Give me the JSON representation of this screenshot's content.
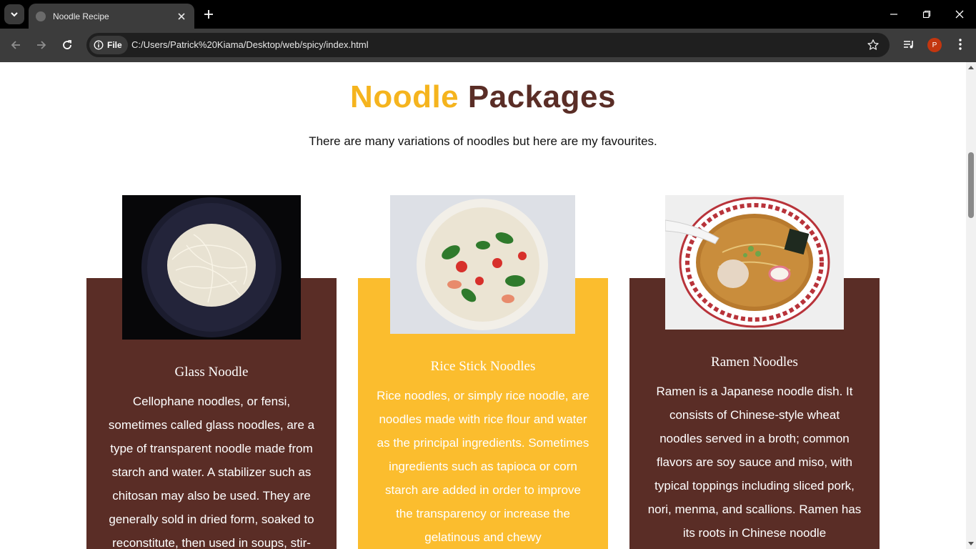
{
  "browser": {
    "tab_title": "Noodle Recipe",
    "chip_label": "File",
    "url": "C:/Users/Patrick%20Kiama/Desktop/web/spicy/index.html",
    "profile_initial": "P"
  },
  "header": {
    "title_word1": "Noodle",
    "title_word2": "Packages",
    "subtitle": "There are many variations of noodles but here are my favourites."
  },
  "colors": {
    "accent_yellow": "#f5b41e",
    "brand_brown": "#5a2d26",
    "card_yellow": "#fbbd2e"
  },
  "cards": [
    {
      "title": "Glass Noodle",
      "text": "Cellophane noodles, or fensi, sometimes called glass noodles, are a type of transparent noodle made from starch and water. A stabilizer such as chitosan may also be used. They are generally sold in dried form, soaked to reconstitute, then used in soups, stir-"
    },
    {
      "title": "Rice Stick Noodles",
      "text": "Rice noodles, or simply rice noodle, are noodles made with rice flour and water as the principal ingredients. Sometimes ingredients such as tapioca or corn starch are added in order to improve the transparency or increase the gelatinous and chewy"
    },
    {
      "title": "Ramen Noodles",
      "text": "Ramen is a Japanese noodle dish. It consists of Chinese-style wheat noodles served in a broth; common flavors are soy sauce and miso, with typical toppings including sliced pork, nori, menma, and scallions. Ramen has its roots in Chinese noodle"
    }
  ]
}
